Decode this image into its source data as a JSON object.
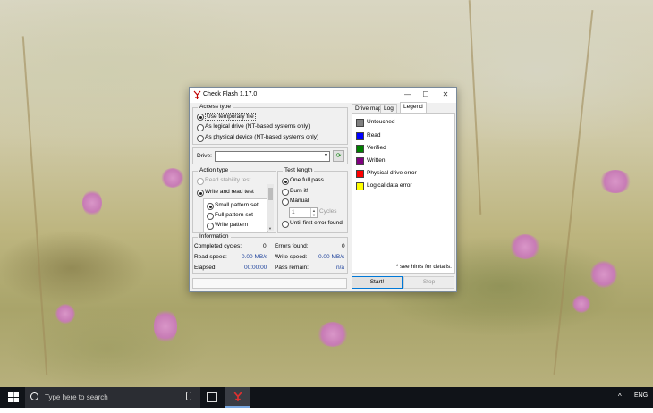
{
  "window": {
    "title": "Check Flash 1.17.0",
    "minimize": "—",
    "maximize": "☐",
    "close": "✕"
  },
  "access_type": {
    "legend": "Access type",
    "options": [
      "Use temporary file",
      "As logical drive (NT-based systems only)",
      "As physical device (NT-based systems only)"
    ],
    "selected": 0
  },
  "drive": {
    "label": "Drive:",
    "value": "",
    "refresh": "⟳"
  },
  "action_type": {
    "legend": "Action type",
    "options": [
      "Read stability test",
      "Write and read test",
      "Small pattern set",
      "Full pattern set",
      "Write pattern"
    ]
  },
  "test_length": {
    "legend": "Test length",
    "options": [
      "One full pass",
      "Burn it!",
      "Manual",
      "Until first error found"
    ],
    "cycles_value": "1",
    "cycles_label": "Cycles"
  },
  "information": {
    "legend": "Information",
    "completed_cycles_label": "Completed cycles:",
    "completed_cycles_value": "0",
    "errors_found_label": "Errors found:",
    "errors_found_value": "0",
    "read_speed_label": "Read speed:",
    "read_speed_value": "0.00 MB/s",
    "write_speed_label": "Write speed:",
    "write_speed_value": "0.00 MB/s",
    "elapsed_label": "Elapsed:",
    "elapsed_value": "00:00:00",
    "pass_remain_label": "Pass remain:",
    "pass_remain_value": "n/a"
  },
  "tabs": [
    "Drive map",
    "Log",
    "Legend"
  ],
  "legend_items": [
    {
      "label": "Untouched",
      "color": "#808080"
    },
    {
      "label": "Read",
      "color": "#0000ff"
    },
    {
      "label": "Verified",
      "color": "#008000"
    },
    {
      "label": "Written",
      "color": "#800080"
    },
    {
      "label": "Physical drive error",
      "color": "#ff0000"
    },
    {
      "label": "Logical data error",
      "color": "#ffff00"
    }
  ],
  "hint": "* see hints for details.",
  "buttons": {
    "start": "Start!",
    "stop": "Stop"
  },
  "taskbar": {
    "search_placeholder": "Type here to search",
    "language": "ENG",
    "tray_chevron": "^"
  }
}
